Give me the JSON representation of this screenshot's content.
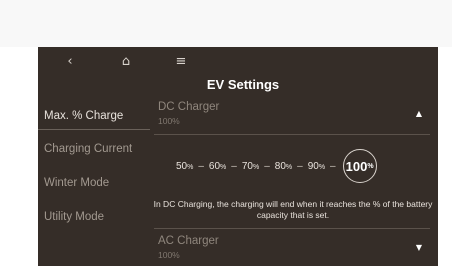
{
  "header": {
    "title": "EV Settings",
    "back_icon": "‹",
    "home_icon": "⌂",
    "menu_icon": "≡"
  },
  "sidebar": {
    "items": [
      {
        "label": "Max. % Charge",
        "active": true
      },
      {
        "label": "Charging Current",
        "active": false
      },
      {
        "label": "Winter Mode",
        "active": false
      },
      {
        "label": "Utility Mode",
        "active": false
      }
    ]
  },
  "dc_charger": {
    "title": "DC Charger",
    "value": "100%",
    "arrow": "▲",
    "options": [
      {
        "num": "50",
        "pct": "%"
      },
      {
        "num": "60",
        "pct": "%"
      },
      {
        "num": "70",
        "pct": "%"
      },
      {
        "num": "80",
        "pct": "%"
      },
      {
        "num": "90",
        "pct": "%"
      }
    ],
    "selected": {
      "num": "100",
      "pct": "%"
    },
    "description": "In DC Charging, the charging will end when it reaches the % of the battery capacity that is set."
  },
  "ac_charger": {
    "title": "AC Charger",
    "value": "100%",
    "arrow": "▼"
  },
  "colors": {
    "screen_bg": "#352d28",
    "text_primary": "#ffffff",
    "text_muted": "#a29990"
  }
}
